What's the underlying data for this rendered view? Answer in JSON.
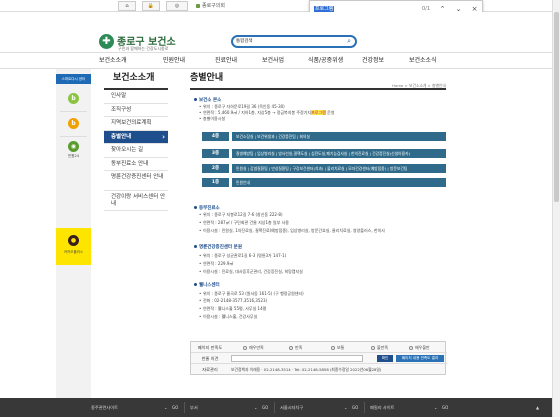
{
  "topbar": {
    "home_icon": "home-icon",
    "lock_icon": "lock-icon",
    "council_label": "종로구의회"
  },
  "findbar": {
    "query": "프로그램",
    "count": "0/1",
    "up_icon": "chevron-up-icon",
    "down_icon": "chevron-down-icon",
    "close_icon": "close-icon"
  },
  "header": {
    "logo_title": "종로구 보건소",
    "logo_sub": "구민과 함께하는 건강도시종로",
    "search_select": "통합검색",
    "search_icon": "search-icon"
  },
  "gnb": {
    "items": [
      "보건소소개",
      "민원안내",
      "진료안내",
      "보건사업",
      "식품/공중위생",
      "건강정보",
      "보건소소식"
    ]
  },
  "rail": {
    "head": "스마트다시 센터",
    "items": [
      {
        "label": "",
        "icon": "b-icon",
        "color": "#8ac53f"
      },
      {
        "label": "",
        "icon": "b-icon",
        "color": "#f0a000"
      },
      {
        "label": "민원24",
        "icon": "minwon-icon",
        "color": "#5a9c2e"
      },
      {
        "label": "카카오플러스",
        "icon": "kakao-icon",
        "color": "#3b1e1e"
      }
    ]
  },
  "lnb": {
    "title": "보건소소개",
    "items": [
      "인사말",
      "조직구성",
      "지역보건의료계획",
      "층별안내",
      "찾아오시는 길",
      "동부진료소 안내",
      "명륜건강증진센터 안내",
      "건강이랑 서비스센터 안내"
    ]
  },
  "content": {
    "title": "층별안내",
    "breadcrumb": "Home > 보건소소개 > 층별안내",
    "main_section": "보건소 본소",
    "main_lines": [
      "위치 : 종로구 자하문로19길 36 (옥인동 45-30)",
      "연면적 : 5,460.9㎡ / 지하1층, 지상5층 → 정금복지봉 주정기지",
      "층별이용시설"
    ],
    "highlight": "프로그램",
    "highlight_suffix": " 운영",
    "floors": [
      {
        "no": "4층",
        "desc": "보건소장실 | 보건위생과 | 건강증진팀 | 회의실"
      },
      {
        "no": "3층",
        "desc": "질병예방팀 | 임상병리실 | 방사선실,결핵도실 | 심전도실,폐기능검사실 | 한의진료실 | 건강증진실(신생아용카)"
      },
      {
        "no": "2층",
        "desc": "민원실 | 감염질환팀 | 만성질환팀 | 구강보건센터(치과) | 물리치료실 | 모자건강센터(예방접종) | 방문보건팀"
      },
      {
        "no": "1층",
        "desc": "민원안내"
      }
    ],
    "dong_section": "동부진료소",
    "dong_lines": [
      "위치 : 종로구 지봉로12길 7-6 (창신동 222-8)",
      "연면적 : 287㎡ / 구민회관 건물 지상1층 일부 사용",
      "이용시설 : 민원실, 1차진료실, 결핵진료(예방접종), 임상병리실, 방문간호실, 물리치료실, 영양플러스, 한의사"
    ],
    "myung_section": "명륜건강증진센터 분원",
    "myung_lines": [
      "위치 : 종로구 성균관로1길 6-3 (명륜3가 147-1)",
      "연면적 : 229.9㎡",
      "이용시설 : 진료실, 대사증후군관리, 건강증진실, 희망캠지실"
    ],
    "well_section": "웰니스센터",
    "well_lines": [
      "위치 : 종로구 율곡로 53 (원서동 161-5) (구 행정공원센터)",
      "전화 : 02-2148-3577,3516,3523)",
      "연면적 : 웰니스홀 55평, 사무실 14평",
      "이용시설 : 웰니스홀, 건강사무실"
    ]
  },
  "survey": {
    "label1": "페이지 만족도",
    "options": [
      "매우만족",
      "만족",
      "보통",
      "불만족",
      "매우불만"
    ],
    "label2": "한줄 의견",
    "submit": "확인",
    "result_btn": "페이지 내용 만족도 결과",
    "label3": "자료관리",
    "manager": "보건정책과 이래용 · 02-2148-3514 · Tel: 02-2148-5858 (최종수정일 2022년06월28일)"
  },
  "footer": {
    "items": [
      "종주관련사이트",
      "부서",
      "서울시자치구",
      "패밀리 사이트"
    ],
    "go": "GO",
    "up": "▲"
  }
}
